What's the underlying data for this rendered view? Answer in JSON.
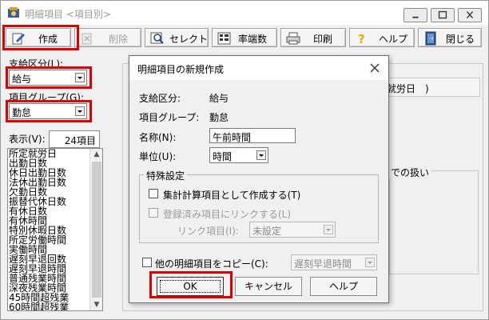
{
  "window": {
    "title": "明細項目 <項目別>"
  },
  "toolbar": {
    "create": "作成",
    "delete": "削除",
    "select": "セレクト",
    "rounding": "率端数",
    "print": "印刷",
    "help": "ヘルプ",
    "close": "閉じる"
  },
  "left": {
    "pay_category_label": "支給区分(L):",
    "pay_category_value": "給与",
    "item_group_label": "項目グループ(G):",
    "item_group_value": "勤怠",
    "display_label": "表示(V):",
    "count": "24項目",
    "items": [
      "所定就労日",
      "出勤日数",
      "休日出勤日数",
      "法休出勤日数",
      "欠勤日数",
      "振替代休日数",
      "有休日数",
      "有休時間",
      "特別休暇日数",
      "所定労働時間",
      "実働時間",
      "遅刻早退回数",
      "遅刻早退時間",
      "普通残業時間",
      "深夜残業時間",
      "45時間超残業",
      "60時間超残業"
    ]
  },
  "background": {
    "field_fragment": "就労日　)",
    "group_fragment": "での扱い"
  },
  "dialog": {
    "title": "明細項目の新規作成",
    "pay_category_label": "支給区分:",
    "pay_category_value": "給与",
    "item_group_label": "項目グループ:",
    "item_group_value": "勤怠",
    "name_label": "名称(N):",
    "name_value": "午前時間",
    "unit_label": "単位(U):",
    "unit_value": "時間",
    "special_legend": "特殊設定",
    "aggregate_label": "集計計算項目として作成する(T)",
    "link_label": "登録済み項目にリンクする(L)",
    "link_item_label": "リンク項目(I):",
    "link_item_value": "未設定",
    "copy_label": "他の明細項目をコピー(C):",
    "copy_value": "遅刻早退時間",
    "ok": "OK",
    "cancel": "キャンセル",
    "help": "ヘルプ"
  },
  "colors": {
    "highlight": "#e00000",
    "window_bg": "#f0f0f0"
  }
}
